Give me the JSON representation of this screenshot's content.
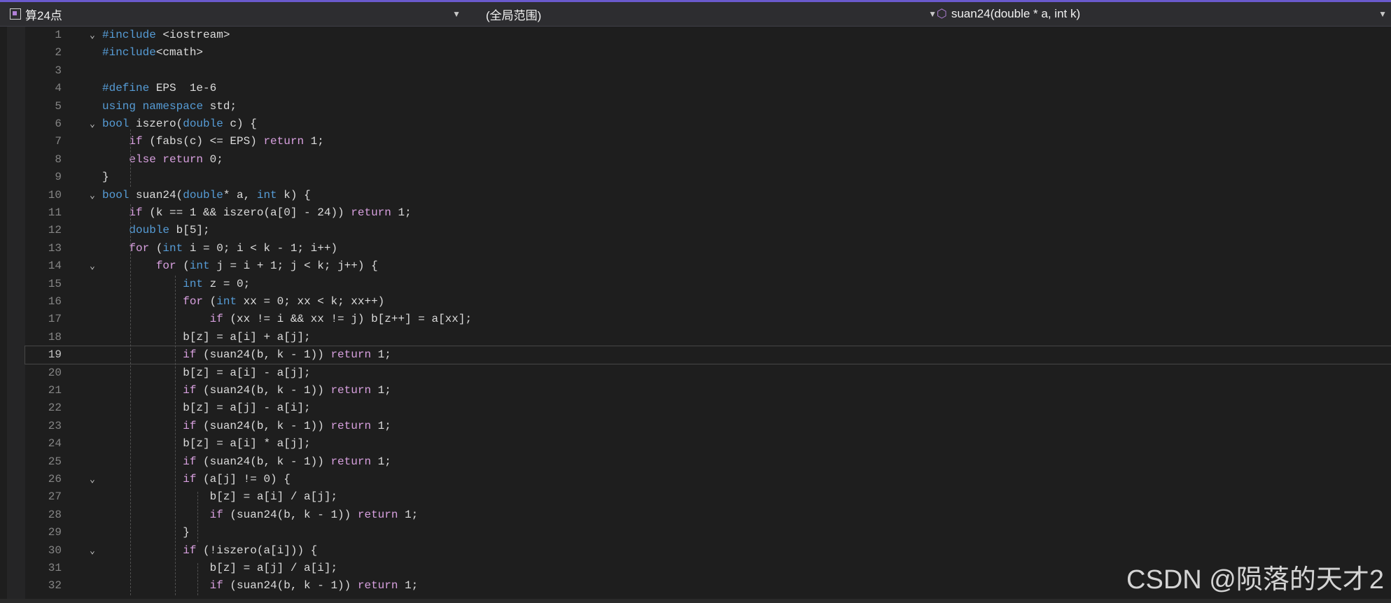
{
  "nav": {
    "project": "算24点",
    "scope": "(全局范围)",
    "member": "suan24(double * a, int k)"
  },
  "editor": {
    "lines": [
      {
        "n": "1",
        "text": "#include <iostream>",
        "fold": true
      },
      {
        "n": "2",
        "text": "#include<cmath>"
      },
      {
        "n": "3",
        "text": ""
      },
      {
        "n": "4",
        "text": "#define EPS  1e-6"
      },
      {
        "n": "5",
        "text": "using namespace std;"
      },
      {
        "n": "6",
        "text": "bool iszero(double c) {",
        "fold": true
      },
      {
        "n": "7",
        "text": "    if (fabs(c) <= EPS) return 1;"
      },
      {
        "n": "8",
        "text": "    else return 0;"
      },
      {
        "n": "9",
        "text": "}"
      },
      {
        "n": "10",
        "text": "bool suan24(double* a, int k) {",
        "fold": true
      },
      {
        "n": "11",
        "text": "    if (k == 1 && iszero(a[0] - 24)) return 1;"
      },
      {
        "n": "12",
        "text": "    double b[5];"
      },
      {
        "n": "13",
        "text": "    for (int i = 0; i < k - 1; i++)"
      },
      {
        "n": "14",
        "text": "        for (int j = i + 1; j < k; j++) {",
        "fold": true
      },
      {
        "n": "15",
        "text": "            int z = 0;"
      },
      {
        "n": "16",
        "text": "            for (int xx = 0; xx < k; xx++)"
      },
      {
        "n": "17",
        "text": "                if (xx != i && xx != j) b[z++] = a[xx];"
      },
      {
        "n": "18",
        "text": "            b[z] = a[i] + a[j];"
      },
      {
        "n": "19",
        "text": "            if (suan24(b, k - 1)) return 1;",
        "current": true
      },
      {
        "n": "20",
        "text": "            b[z] = a[i] - a[j];"
      },
      {
        "n": "21",
        "text": "            if (suan24(b, k - 1)) return 1;"
      },
      {
        "n": "22",
        "text": "            b[z] = a[j] - a[i];"
      },
      {
        "n": "23",
        "text": "            if (suan24(b, k - 1)) return 1;"
      },
      {
        "n": "24",
        "text": "            b[z] = a[i] * a[j];"
      },
      {
        "n": "25",
        "text": "            if (suan24(b, k - 1)) return 1;"
      },
      {
        "n": "26",
        "text": "            if (a[j] != 0) {",
        "fold": true
      },
      {
        "n": "27",
        "text": "                b[z] = a[i] / a[j];"
      },
      {
        "n": "28",
        "text": "                if (suan24(b, k - 1)) return 1;"
      },
      {
        "n": "29",
        "text": "            }"
      },
      {
        "n": "30",
        "text": "            if (!iszero(a[i])) {",
        "fold": true
      },
      {
        "n": "31",
        "text": "                b[z] = a[j] / a[i];"
      },
      {
        "n": "32",
        "text": "                if (suan24(b, k - 1)) return 1;"
      }
    ]
  },
  "watermark": "CSDN @陨落的天才2"
}
